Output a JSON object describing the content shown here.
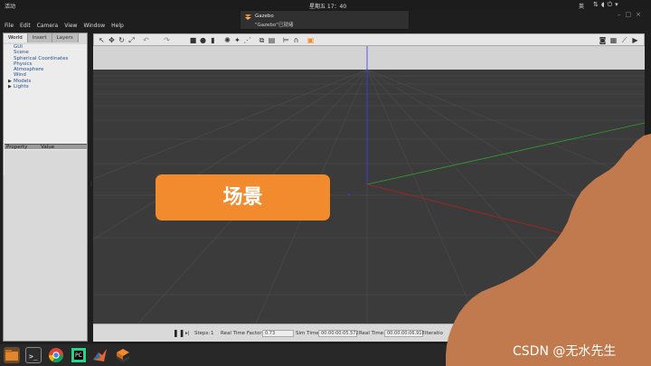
{
  "topbar": {
    "activities": "活动",
    "clock": "星期五 17：40",
    "ime": "英"
  },
  "notification": {
    "title": "Gazebo",
    "body": "\"Gazebo\"已就绪"
  },
  "menu": [
    "File",
    "Edit",
    "Camera",
    "View",
    "Window",
    "Help"
  ],
  "left_panel": {
    "tabs": [
      "World",
      "Insert",
      "Layers"
    ],
    "tree": [
      "GUI",
      "Scene",
      "Spherical Coordinates",
      "Physics",
      "Atmosphere",
      "Wind",
      "Models",
      "Lights"
    ],
    "property_header": "Property",
    "value_header": "Value"
  },
  "callout": "场景",
  "status": {
    "steps_label": "Steps:",
    "steps_value": "1",
    "rtf_label": "Real Time Factor:",
    "rtf_value": "0.73",
    "sim_label": "Sim Time:",
    "sim_value": "00:00:00:05.572",
    "real_label": "Real Time:",
    "real_value": "00:00:00:06.918",
    "iter_label": "Iteratio"
  },
  "watermark": "CSDN @无水先生",
  "colors": {
    "accent": "#f28a2e",
    "hill": "#c07a4e",
    "grid": "#4a4a4a"
  }
}
